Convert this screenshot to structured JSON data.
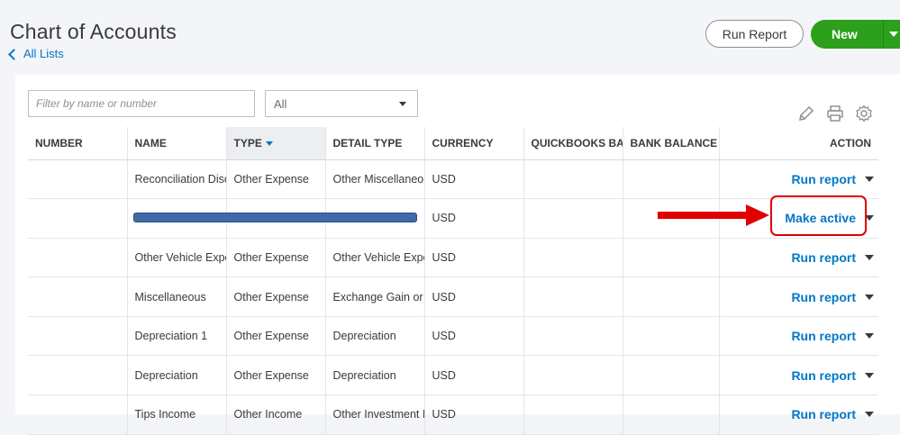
{
  "header": {
    "title": "Chart of Accounts",
    "back_link": "All Lists",
    "run_report_label": "Run Report",
    "new_label": "New"
  },
  "filters": {
    "search_placeholder": "Filter by name or number",
    "type_select_value": "All"
  },
  "toolbar_icons": [
    "pencil-icon",
    "print-icon",
    "gear-icon"
  ],
  "table": {
    "columns": [
      "NUMBER",
      "NAME",
      "TYPE",
      "DETAIL TYPE",
      "CURRENCY",
      "QUICKBOOKS BALANCE",
      "BANK BALANCE",
      "ACTION"
    ],
    "sorted_column": "TYPE",
    "rows": [
      {
        "number": "",
        "name": "Reconciliation Discrepancies",
        "type": "Other Expense",
        "detail": "Other Miscellaneous Expense",
        "currency": "USD",
        "qb_balance": "",
        "bank_balance": "",
        "action": "Run report"
      },
      {
        "number": "",
        "name": "",
        "type": "",
        "detail": "",
        "currency": "USD",
        "qb_balance": "",
        "bank_balance": "",
        "action": "Make active"
      },
      {
        "number": "",
        "name": "Other Vehicle Expenses",
        "type": "Other Expense",
        "detail": "Other Vehicle Expenses",
        "currency": "USD",
        "qb_balance": "",
        "bank_balance": "",
        "action": "Run report"
      },
      {
        "number": "",
        "name": "Miscellaneous",
        "type": "Other Expense",
        "detail": "Exchange Gain or Loss",
        "currency": "USD",
        "qb_balance": "",
        "bank_balance": "",
        "action": "Run report"
      },
      {
        "number": "",
        "name": "Depreciation 1",
        "type": "Other Expense",
        "detail": "Depreciation",
        "currency": "USD",
        "qb_balance": "",
        "bank_balance": "",
        "action": "Run report"
      },
      {
        "number": "",
        "name": "Depreciation",
        "type": "Other Expense",
        "detail": "Depreciation",
        "currency": "USD",
        "qb_balance": "",
        "bank_balance": "",
        "action": "Run report"
      },
      {
        "number": "",
        "name": "Tips Income",
        "type": "Other Income",
        "detail": "Other Investment Income",
        "currency": "USD",
        "qb_balance": "",
        "bank_balance": "",
        "action": "Run report"
      }
    ]
  },
  "annotation": {
    "arrow_color": "#e00000",
    "box_color": "#e00000",
    "redaction_color": "#3e6aa8"
  },
  "colors": {
    "accent_green": "#2ca01c",
    "link_blue": "#0077c5"
  }
}
